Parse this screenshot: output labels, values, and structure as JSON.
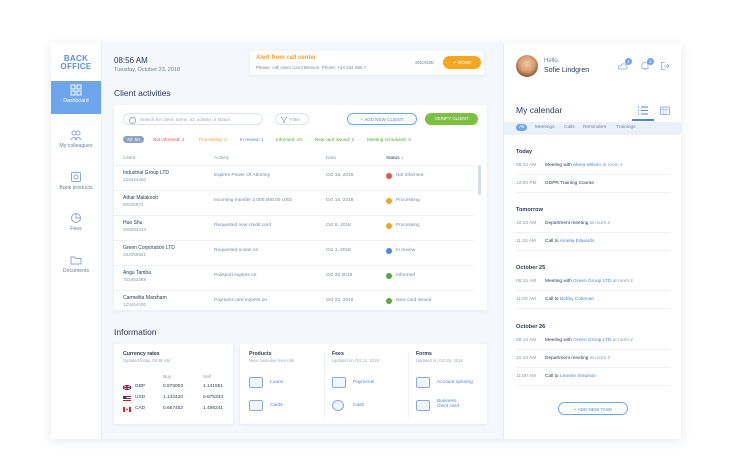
{
  "sidebar": {
    "logo_line1": "BACK",
    "logo_line2": "OFFICE",
    "items": [
      {
        "label": "Dashboard"
      },
      {
        "label": "My colleagues"
      },
      {
        "label": "Bank products"
      },
      {
        "label": "Fees"
      },
      {
        "label": "Documents"
      }
    ]
  },
  "header": {
    "time": "08:56 AM",
    "date": "Tuesday, October 23, 2018",
    "alert": {
      "title": "Alert from call center",
      "text": "Please, call client Carol Benson. Phone: +44 234 566 7",
      "snooze": "SNOOZE",
      "done": "DONE"
    }
  },
  "clients": {
    "title": "Client activities",
    "search_placeholder": "Search for client, name, ID, activity or status",
    "filter": "Filter",
    "add_client": "+ ADD NEW CLIENT",
    "verify_client": "VERIFY CLIENT",
    "chips": [
      {
        "label": "All: 50",
        "color": "#ffffff"
      },
      {
        "label": "Not informed: 1",
        "color": "#e0524f"
      },
      {
        "label": "Processing: 2",
        "color": "#f0a22b"
      },
      {
        "label": "In review: 1",
        "color": "#4f86d6"
      },
      {
        "label": "Informed: 43",
        "color": "#5aa83c"
      },
      {
        "label": "New card issued: 2",
        "color": "#5aa83c"
      },
      {
        "label": "Meeting scheduled: 3",
        "color": "#5aa83c"
      }
    ],
    "columns": [
      "Client",
      "Activity",
      "Date",
      "Status"
    ],
    "rows": [
      {
        "name": "Industrial Group LTD",
        "id": "123444400",
        "activity": "Expires Power Of Attorney",
        "date": "Oct 15, 2018",
        "status": "Not informed",
        "color": "#e0524f"
      },
      {
        "name": "Athar Malakooti",
        "id": "60035973",
        "activity": "Incoming transfer 2,000,000.00 USD",
        "date": "Oct 15, 2018",
        "status": "Processing",
        "color": "#f0a22b"
      },
      {
        "name": "Huo Shu",
        "id": "200033344",
        "activity": "Requested new credit card",
        "date": "Oct 9, 2018",
        "status": "Processing",
        "color": "#f0a22b"
      },
      {
        "name": "Green Corporation LTD",
        "id": "333355551",
        "activity": "Requested a loan on",
        "date": "Oct 1, 2018",
        "status": "In review",
        "color": "#4f86d6"
      },
      {
        "name": "Angu Tamba",
        "id": "751953369",
        "activity": "Passport expires on",
        "date": "Oct 20 2018",
        "status": "Informed",
        "color": "#5aa83c"
      },
      {
        "name": "Carmelita Marsham",
        "id": "123444400",
        "activity": "Payment card expires on",
        "date": "Oct 23, 2018",
        "status": "New card issued",
        "color": "#5aa83c"
      }
    ]
  },
  "information": {
    "title": "Information",
    "currency": {
      "title": "Currency rates",
      "updated": "Updated today, 08:56 AM",
      "buy_label": "Buy",
      "sell_label": "Sell",
      "rows": [
        {
          "code": "GBP",
          "buy": "0.876003",
          "sell": "1.141551"
        },
        {
          "code": "USD",
          "buy": "1.142420",
          "sell": "0.875334"
        },
        {
          "code": "CAD",
          "buy": "0.667452",
          "sell": "1.498241"
        }
      ]
    },
    "products": {
      "title": "Products",
      "sub": "New consumer fees rate",
      "items": [
        "Loans",
        "Cards"
      ]
    },
    "fees": {
      "title": "Fees",
      "sub": "Updated on Oct 21, 2018",
      "items": [
        "Payments",
        "Cash"
      ]
    },
    "forms": {
      "title": "Forms",
      "sub": "Updated on Oct 25, 2018",
      "items": [
        "Account opening",
        "Business",
        "client card"
      ]
    }
  },
  "user": {
    "hello": "Hello,",
    "name": "Sofie Lindgren",
    "badge1": "1",
    "badge2": "2"
  },
  "calendar": {
    "title": "My calendar",
    "filters": [
      "All",
      "Meetings",
      "Calls",
      "Reminders",
      "Trainings"
    ],
    "days": [
      {
        "label": "Today",
        "events": [
          {
            "time": "09:15 AM",
            "pre": "Meeting with",
            "link": "Maria Wilson",
            "post": "at room 2"
          },
          {
            "time": "12:20 PM",
            "pre": "GDPR Training Course",
            "link": "",
            "post": ""
          }
        ]
      },
      {
        "label": "Tomorrow",
        "events": [
          {
            "time": "10:15 AM",
            "pre": "Department meeting",
            "link": "",
            "post": "at room 2"
          },
          {
            "time": "11:40 AM",
            "pre": "Call to",
            "link": "Amelia Edwards",
            "post": ""
          }
        ]
      },
      {
        "label": "October 25",
        "events": [
          {
            "time": "09:15 AM",
            "pre": "Meeting with",
            "link": "Green Group LTD",
            "post": "at room 2"
          },
          {
            "time": "11:00 AM",
            "pre": "Call to",
            "link": "Bobby Coleman",
            "post": ""
          }
        ]
      },
      {
        "label": "October 26",
        "events": [
          {
            "time": "09:15 AM",
            "pre": "Meeting with",
            "link": "Green Group LTD",
            "post": "at room 2"
          },
          {
            "time": "10:15 AM",
            "pre": "Department meeting",
            "link": "",
            "post": "at room 2"
          },
          {
            "time": "11:00 AM",
            "pre": "Call to",
            "link": "Leanne Simpson",
            "post": ""
          }
        ]
      }
    ],
    "add_task": "+ ADD NEW TASK"
  },
  "colors": {
    "accent": "#6ea6ec",
    "primary_text": "#2b3a55",
    "success": "#7cc043",
    "warning": "#f5a623",
    "danger": "#e0524f"
  }
}
